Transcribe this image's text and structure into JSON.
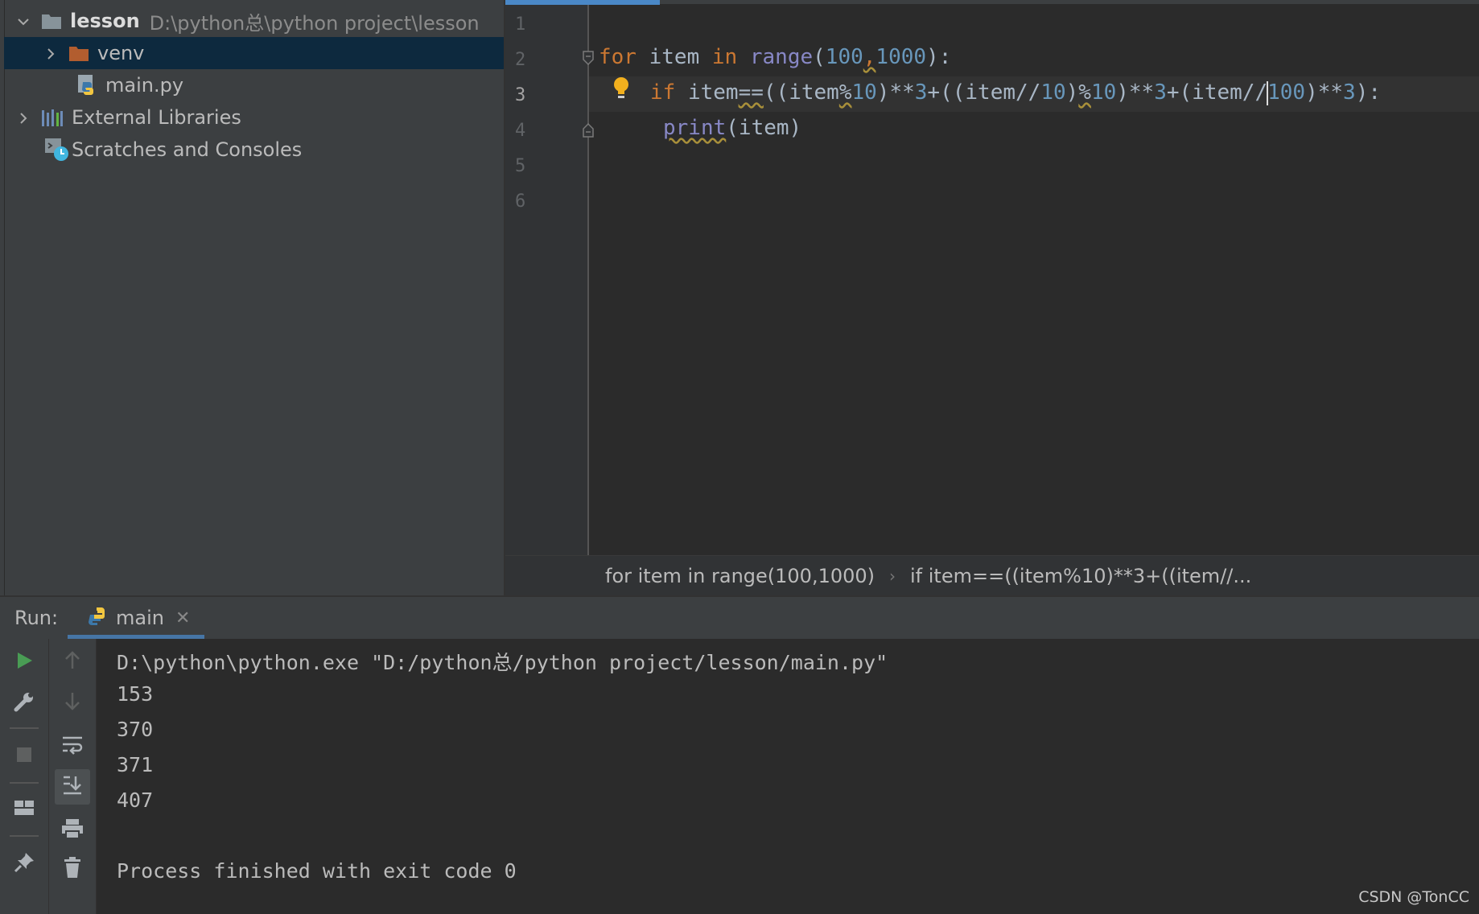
{
  "project": {
    "root": {
      "name": "lesson",
      "path": "D:\\python总\\python project\\lesson"
    },
    "items": [
      {
        "label": "venv"
      },
      {
        "label": "main.py"
      },
      {
        "label": "External Libraries"
      },
      {
        "label": "Scratches and Consoles"
      }
    ]
  },
  "editor": {
    "line_numbers": [
      "1",
      "2",
      "3",
      "4",
      "5",
      "6"
    ],
    "current_line": "3",
    "code": {
      "l2": {
        "kw1": "for",
        "t1": " item ",
        "kw2": "in",
        "t2": " ",
        "bi1": "range",
        "t3": "(",
        "n1": "100",
        "t4": ",",
        "n2": "1000",
        "t5": "):"
      },
      "l3": {
        "kw1": "if",
        "t1": " item",
        "t2": "==",
        "t3": "((item",
        "t4": "%",
        "n1": "10",
        "t5": ")**",
        "n2": "3",
        "t6": "+((item//",
        "n3": "10",
        "t7": ")",
        "t8": "%",
        "n4": "10",
        "t9": ")**",
        "n5": "3",
        "t10": "+(item//",
        "n6": "100",
        "t11": ")**",
        "n7": "3",
        "t12": "):"
      },
      "l4": {
        "bi1": "print",
        "t1": "(item)"
      }
    },
    "breadcrumbs": [
      "for item in range(100,1000)",
      "if item==((item%10)**3+((item//..."
    ]
  },
  "run": {
    "label": "Run:",
    "tab": "main",
    "output": [
      "D:\\python\\python.exe \"D:/python总/python project/lesson/main.py\"",
      "153",
      "370",
      "371",
      "407",
      "",
      "Process finished with exit code 0"
    ]
  },
  "watermark": "CSDN @TonCC",
  "colors": {
    "keyword": "#cc7832",
    "number": "#6897bb",
    "builtin": "#8888c6",
    "selection": "#0d293e",
    "accent": "#4a88c7"
  }
}
